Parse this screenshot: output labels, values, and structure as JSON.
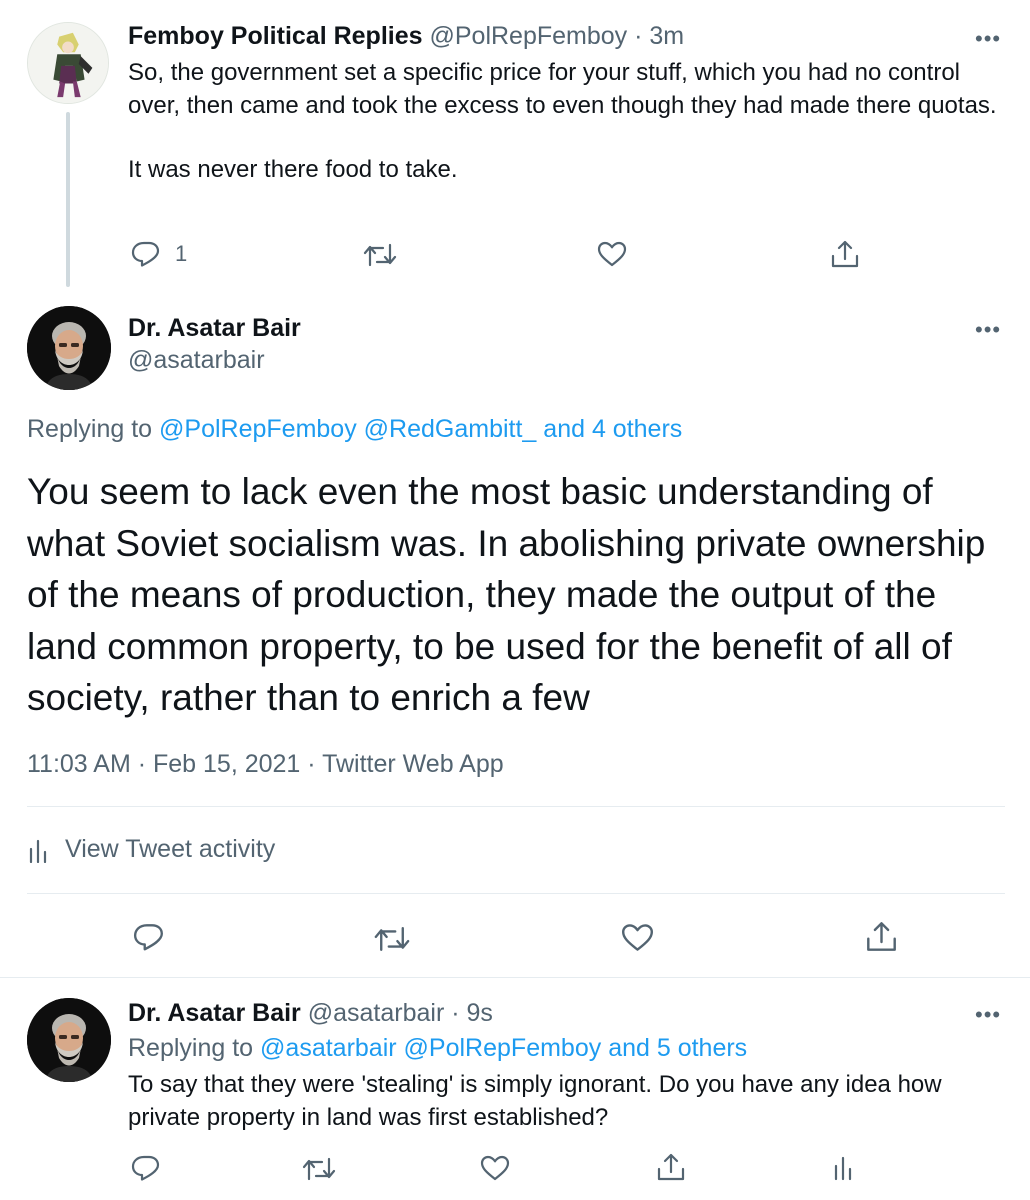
{
  "tweet1": {
    "name": "Femboy Political Replies",
    "handle": "@PolRepFemboy",
    "sep": "·",
    "time": "3m",
    "text_p1": "So, the government set a specific price for your stuff, which you had no control over, then came and took the excess to even though they had made there quotas.",
    "text_p2": "It was never there food to take.",
    "reply_count": "1",
    "avatar": "anime-character-avatar"
  },
  "tweet2": {
    "name": "Dr. Asatar Bair",
    "handle": "@asatarbair",
    "replying_prefix": "Replying to",
    "replying_to": [
      "@PolRepFemboy",
      "@RedGambitt_",
      "and 4 others"
    ],
    "text": "You seem to lack even the most basic understanding of what Soviet socialism was. In abolishing private ownership of the means of production, they made the output of the land common property, to be used for the benefit of all of society, rather than to enrich a few",
    "meta": "11:03 AM · Feb 15, 2021 · Twitter Web App",
    "activity_label": "View Tweet activity",
    "avatar": "bearded-man-avatar"
  },
  "tweet3": {
    "name": "Dr. Asatar Bair",
    "handle": "@asatarbair",
    "sep": "·",
    "time": "9s",
    "replying_prefix": "Replying to",
    "replying_to": [
      "@asatarbair",
      "@PolRepFemboy",
      "and 5 others"
    ],
    "text": "To say that they were 'stealing' is simply ignorant. Do you have any idea how private property in land was first established?"
  },
  "icons": {
    "reply": "reply-icon",
    "retweet": "retweet-icon",
    "like": "like-icon",
    "share": "share-icon",
    "analytics": "analytics-icon",
    "more": "more-icon"
  },
  "colors": {
    "text": "#0f1419",
    "muted": "#536471",
    "link": "#1d9bf0",
    "divider": "#e6ecf0"
  }
}
